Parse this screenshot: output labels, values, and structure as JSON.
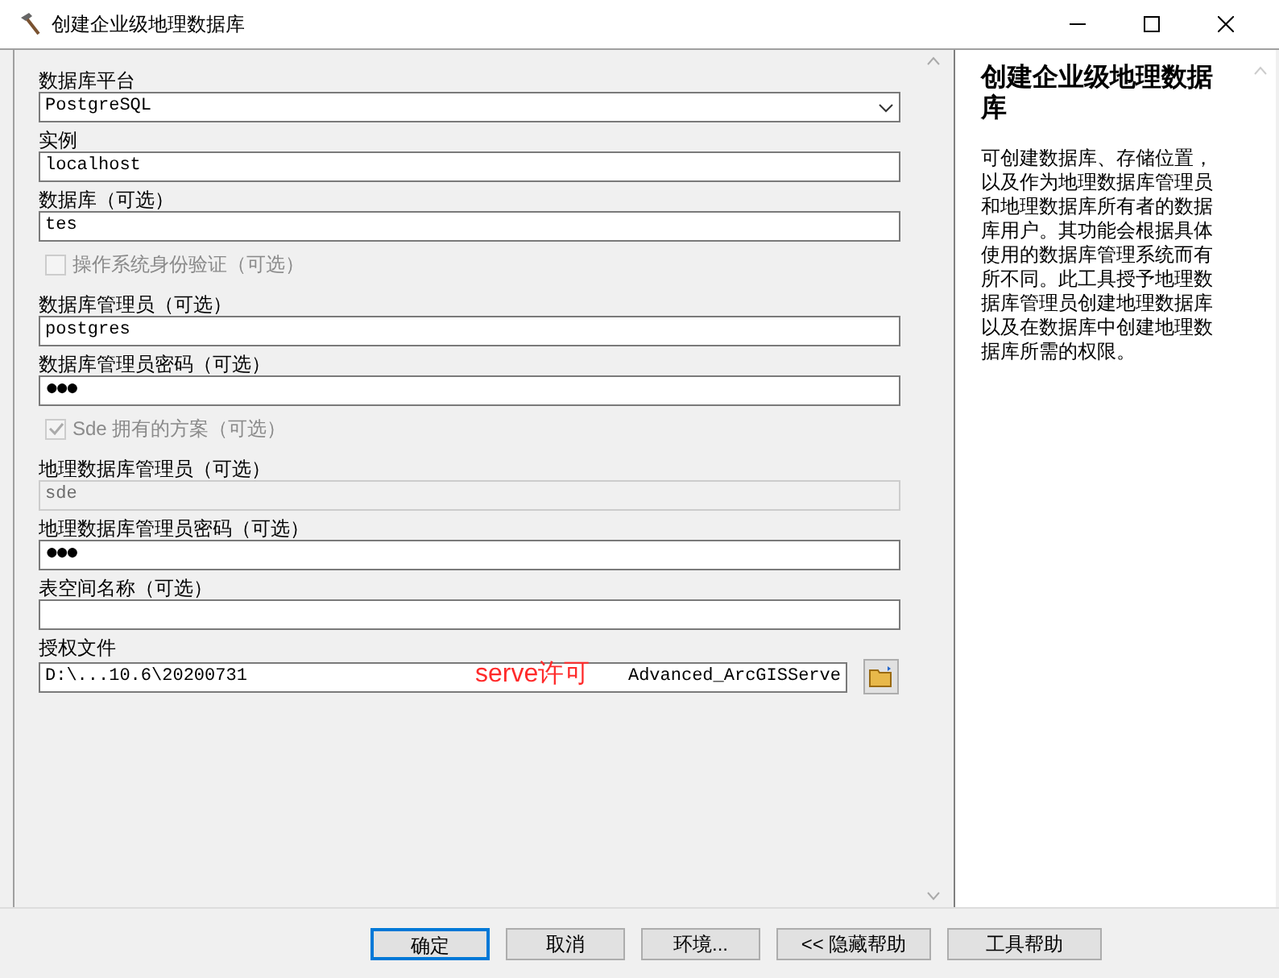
{
  "window": {
    "title": "创建企业级地理数据库"
  },
  "fields": [
    {
      "kind": "select",
      "label": "数据库平台",
      "value": "PostgreSQL"
    },
    {
      "kind": "text",
      "label": "实例",
      "value": "localhost"
    },
    {
      "kind": "text",
      "label": "数据库（可选）",
      "value": "tes"
    },
    {
      "kind": "checkbox",
      "label": "操作系统身份验证（可选）",
      "checked": false,
      "disabled": true
    },
    {
      "kind": "text",
      "label": "数据库管理员（可选）",
      "value": "postgres"
    },
    {
      "kind": "password",
      "label": "数据库管理员密码（可选）",
      "value": "●●●"
    },
    {
      "kind": "checkbox",
      "label": "Sde 拥有的方案（可选）",
      "checked": true,
      "disabled": true
    },
    {
      "kind": "text",
      "label": "地理数据库管理员（可选）",
      "value": "sde",
      "disabled": true
    },
    {
      "kind": "password",
      "label": "地理数据库管理员密码（可选）",
      "value": "●●●"
    },
    {
      "kind": "text",
      "label": "表空间名称（可选）"
    },
    {
      "kind": "file",
      "label": "授权文件",
      "value": "D:\\...10.6\\20200731",
      "value_end": "Advanced_ArcGISServe",
      "annotation": "serve许可"
    }
  ],
  "help": {
    "title": "创建企业级地理数据库",
    "text": "可创建数据库、存储位置，以及作为地理数据库管理员和地理数据库所有者的数据库用户。其功能会根据具体使用的数据库管理系统而有所不同。此工具授予地理数据库管理员创建地理数据库以及在数据库中创建地理数据库所需的权限。"
  },
  "buttons": [
    {
      "label": "确定",
      "selected": true
    },
    {
      "label": "取消",
      "selected": false
    },
    {
      "label": "环境...",
      "selected": false
    },
    {
      "label": "<< 隐藏帮助",
      "selected": false
    },
    {
      "label": "工具帮助",
      "selected": false
    }
  ]
}
